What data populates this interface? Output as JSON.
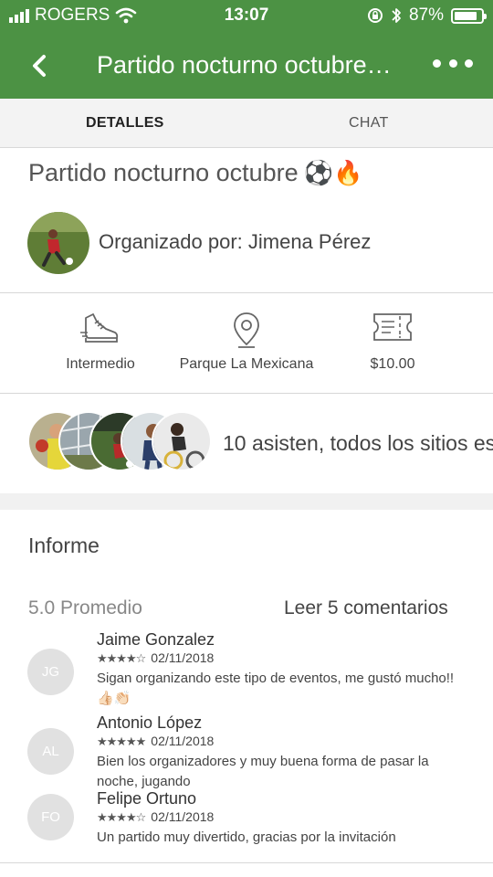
{
  "status_bar": {
    "carrier": "ROGERS",
    "time": "13:07",
    "battery": "87%",
    "battery_level": 0.87
  },
  "nav": {
    "title": "Partido nocturno octubre…",
    "back_icon": "chevron-left-icon",
    "more_icon": "more-horizontal-icon"
  },
  "tabs": [
    {
      "label": "DETALLES",
      "active": true
    },
    {
      "label": "CHAT",
      "active": false
    }
  ],
  "event": {
    "title": "Partido nocturno octubre",
    "title_emojis": "⚽🔥",
    "organizer_text": "Organizado por: Jimena Pérez"
  },
  "features": [
    {
      "icon": "shoe-icon",
      "label": "Intermedio"
    },
    {
      "icon": "location-pin-icon",
      "label": "Parque La Mexicana"
    },
    {
      "icon": "ticket-icon",
      "label": "$10.00"
    }
  ],
  "attendees": {
    "text": "10 asisten, todos los sitios est"
  },
  "report": {
    "heading": "Informe",
    "average": "5.0 Promedio",
    "read_reviews": "Leer 5 comentarios",
    "reviews": [
      {
        "initials": "JG",
        "name": "Jaime Gonzalez",
        "stars": "★★★★☆",
        "rating": 4,
        "date": "02/11/2018",
        "text": "Sigan organizando este tipo de eventos, me gustó mucho!! 👍🏻👏🏻"
      },
      {
        "initials": "AL",
        "name": "Antonio López",
        "stars": "★★★★★",
        "rating": 5,
        "date": "02/11/2018",
        "text": "Bien los organizadores y muy buena forma de pasar la noche, jugando"
      },
      {
        "initials": "FO",
        "name": "Felipe Ortuno",
        "stars": "★★★★☆",
        "rating": 4,
        "date": "02/11/2018",
        "text": "Un partido muy divertido, gracias por la invitación"
      }
    ]
  },
  "colors": {
    "header_green": "#4c9244",
    "tab_background": "#f3f3f3"
  }
}
